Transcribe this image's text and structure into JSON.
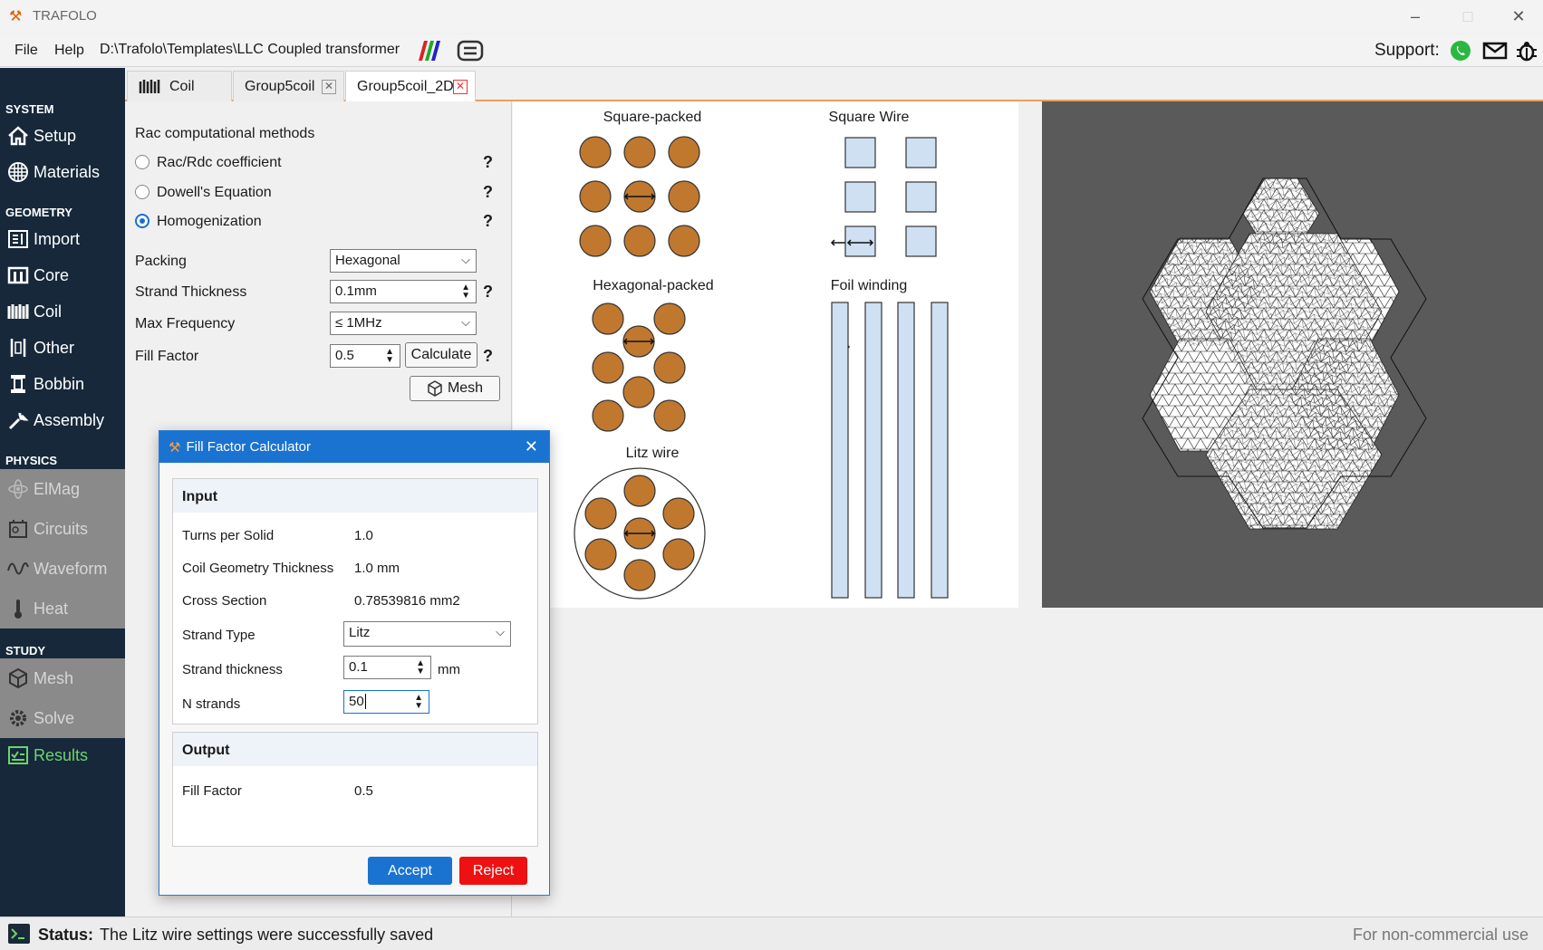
{
  "app": {
    "title": "TRAFOLO",
    "file_path": "D:\\Trafolo\\Templates\\LLC Coupled transformer"
  },
  "menu": {
    "file": "File",
    "help": "Help"
  },
  "support": {
    "label": "Support:"
  },
  "sidebar": {
    "system": "SYSTEM",
    "setup": "Setup",
    "materials": "Materials",
    "geometry": "GEOMETRY",
    "import": "Import",
    "core": "Core",
    "coil": "Coil",
    "other": "Other",
    "bobbin": "Bobbin",
    "assembly": "Assembly",
    "physics": "PHYSICS",
    "elmag": "ElMag",
    "circuits": "Circuits",
    "waveform": "Waveform",
    "heat": "Heat",
    "study": "STUDY",
    "mesh": "Mesh",
    "solve": "Solve",
    "results": "Results"
  },
  "tabs": {
    "coil": "Coil",
    "group5coil": "Group5coil",
    "group5coil_2d": "Group5coil_2D"
  },
  "panel": {
    "rac_title": "Rac computational methods",
    "opt_rac": "Rac/Rdc coefficient",
    "opt_dowell": "Dowell's Equation",
    "opt_homog": "Homogenization",
    "help": "?",
    "packing_label": "Packing",
    "packing_value": "Hexagonal",
    "strand_label": "Strand Thickness",
    "strand_value": "0.1mm",
    "freq_label": "Max Frequency",
    "freq_value": "≤ 1MHz",
    "fill_label": "Fill Factor",
    "fill_value": "0.5",
    "calculate": "Calculate",
    "mesh": "Mesh"
  },
  "canvas": {
    "square_packed": "Square-packed",
    "square_wire": "Square Wire",
    "hex_packed": "Hexagonal-packed",
    "foil": "Foil winding",
    "litz": "Litz wire",
    "colors": {
      "strand": "#c0782f",
      "square": "#cfe0f3"
    }
  },
  "dialog": {
    "title": "Fill Factor Calculator",
    "input_header": "Input",
    "turns_label": "Turns per Solid",
    "turns_value": "1.0",
    "geom_label": "Coil Geometry Thickness",
    "geom_value": "1.0 mm",
    "cross_label": "Cross Section",
    "cross_value": "0.78539816 mm2",
    "type_label": "Strand Type",
    "type_value": "Litz",
    "thick_label": "Strand thickness",
    "thick_value": "0.1",
    "thick_unit": "mm",
    "n_label": "N strands",
    "n_value": "50",
    "output_header": "Output",
    "fill_label": "Fill Factor",
    "fill_value": "0.5",
    "accept": "Accept",
    "reject": "Reject"
  },
  "status": {
    "label": "Status:",
    "message": "The Litz wire settings were successfully saved",
    "license": "For non-commercial use"
  }
}
